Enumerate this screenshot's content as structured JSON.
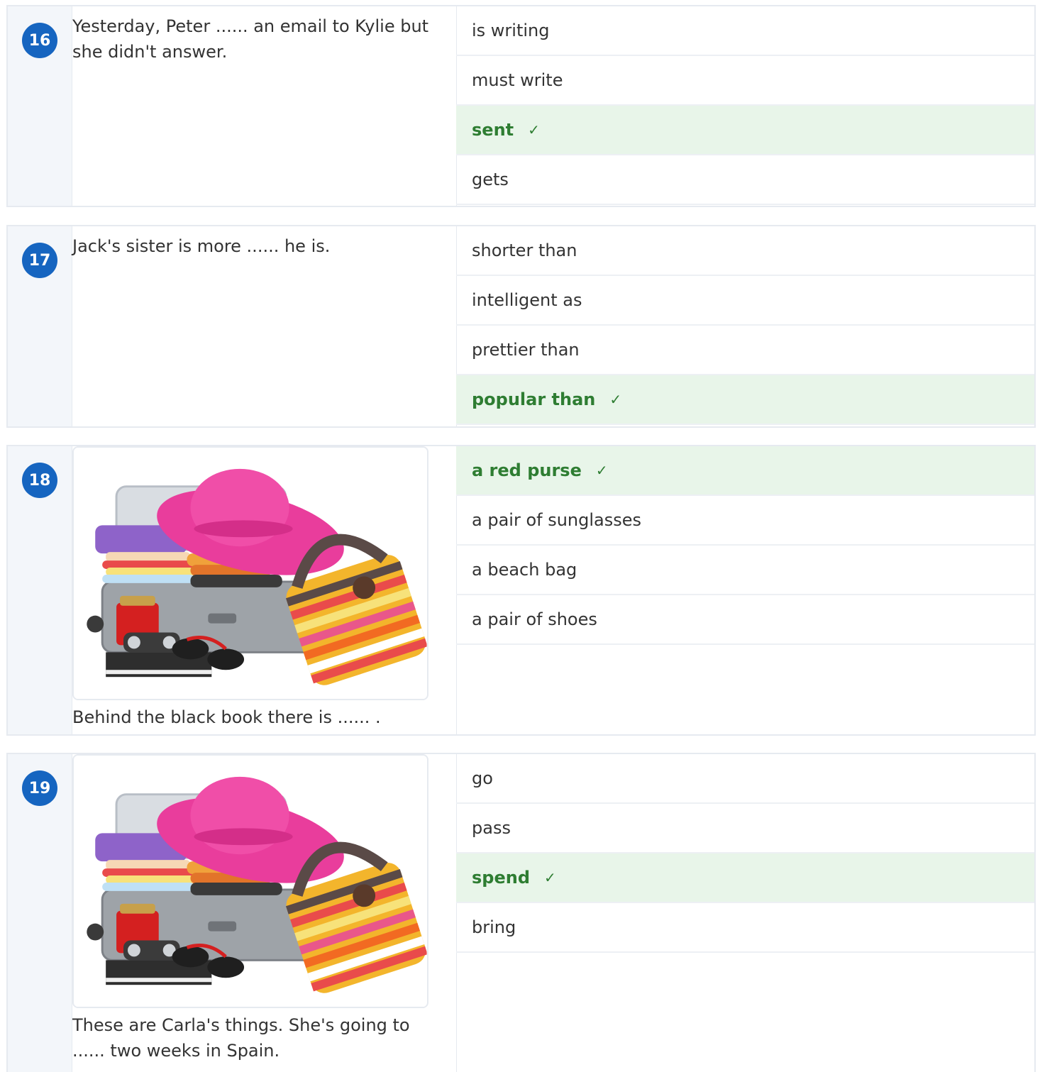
{
  "questions": [
    {
      "number": "16",
      "text": "Yesterday, Peter ...... an email to Kylie but she didn't answer.",
      "options": [
        "is writing",
        "must write",
        "sent",
        "gets"
      ],
      "correct": 2
    },
    {
      "number": "17",
      "text": "Jack's sister is more ...... he is.",
      "options": [
        "shorter than",
        "intelligent as",
        "prettier than",
        "popular than"
      ],
      "correct": 3
    },
    {
      "number": "18",
      "text": "Behind the black book there is ...... .",
      "options": [
        "a red purse",
        "a pair of sunglasses",
        "a beach bag",
        "a pair of shoes"
      ],
      "correct": 0
    },
    {
      "number": "19",
      "text": "These are Carla's things. She's going to ...... two weeks in Spain.",
      "options": [
        "go",
        "pass",
        "spend",
        "bring"
      ],
      "correct": 2
    }
  ],
  "check_mark": "✓",
  "colors": {
    "badge": "#1665c0",
    "correct_bg": "#e8f5e9",
    "correct_text": "#2e7d32"
  }
}
